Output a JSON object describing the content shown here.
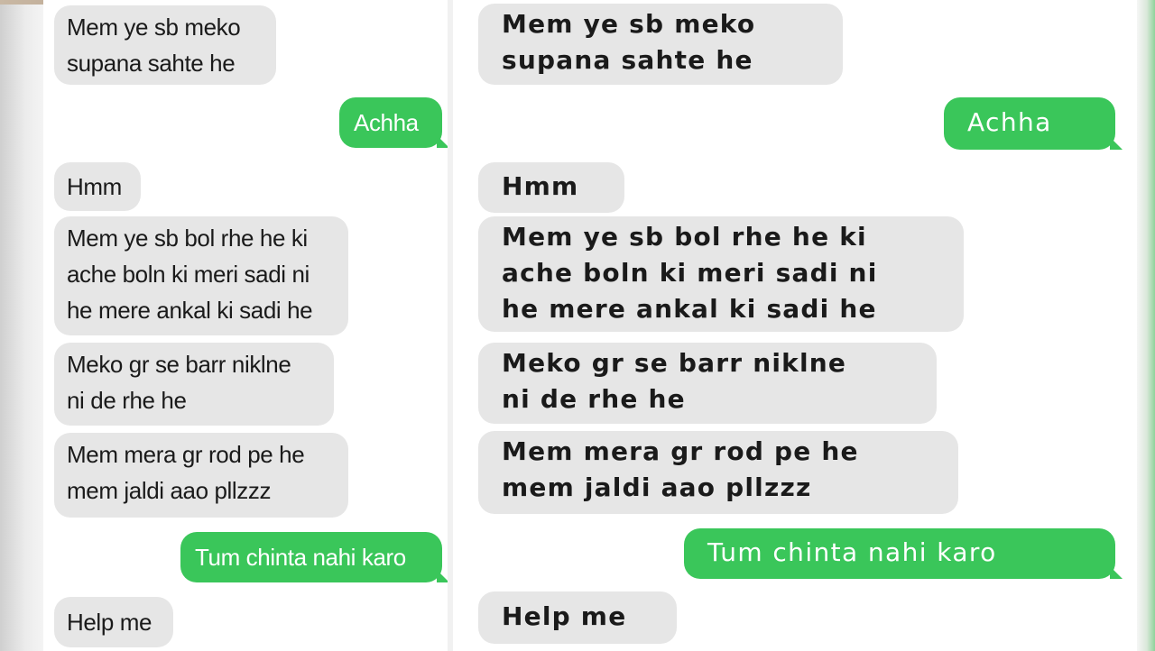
{
  "chat": {
    "messages": [
      {
        "from": "them",
        "text": "Mem ye sb meko\nsupana sahte he"
      },
      {
        "from": "me",
        "text": "Achha"
      },
      {
        "from": "them",
        "text": "Hmm"
      },
      {
        "from": "them",
        "text": "Mem ye sb bol rhe he ki\nache boln ki meri sadi ni\nhe mere ankal ki sadi he"
      },
      {
        "from": "them",
        "text": "Meko gr se barr niklne\nni de rhe he"
      },
      {
        "from": "them",
        "text": "Mem mera gr rod pe he\nmem jaldi aao pllzzz"
      },
      {
        "from": "me",
        "text": "Tum chinta nahi karo"
      },
      {
        "from": "them",
        "text": "Help me"
      }
    ]
  },
  "colors": {
    "incoming_bubble": "#e6e6e6",
    "outgoing_bubble": "#3ac65a",
    "outgoing_text": "#ffffff"
  }
}
